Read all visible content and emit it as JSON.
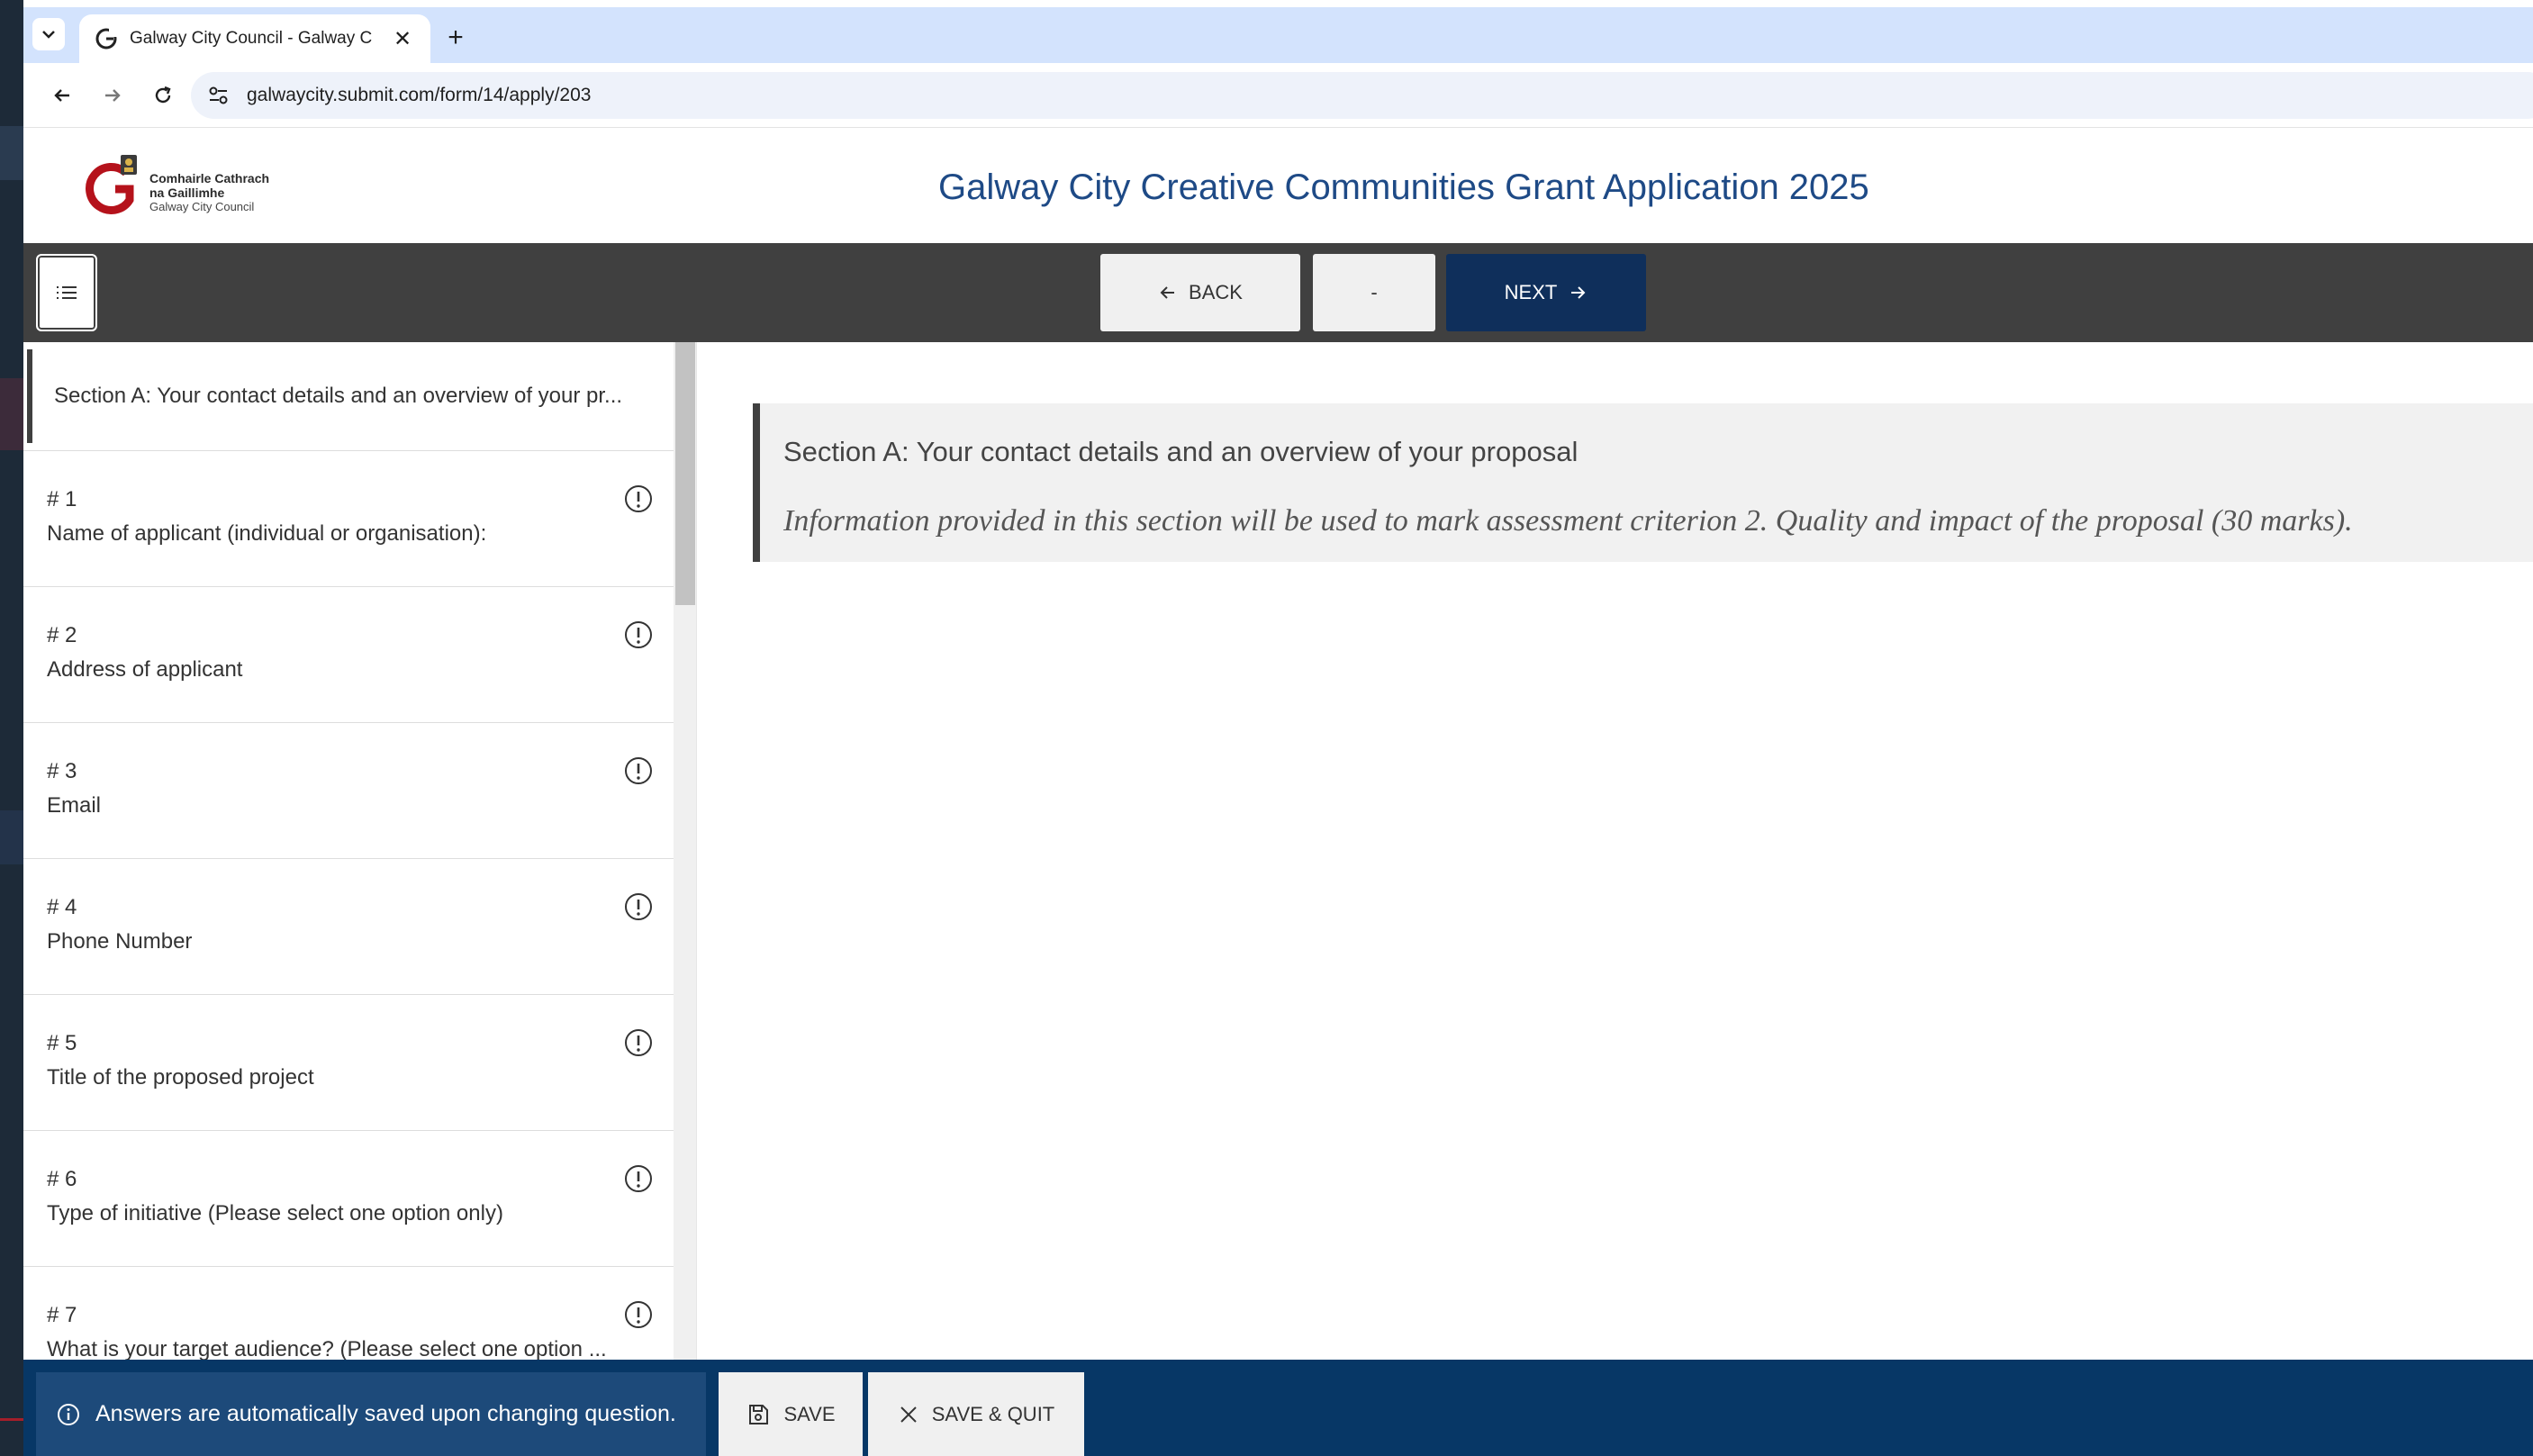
{
  "browser": {
    "tab_title": "Galway City Council - Galway C",
    "url": "galwaycity.submit.com/form/14/apply/203"
  },
  "header": {
    "logo_line1": "Comhairle Cathrach",
    "logo_line2": "na Gaillimhe",
    "logo_line3": "Galway City Council",
    "title": "Galway City Creative Communities Grant Application 2025"
  },
  "nav": {
    "back_label": "BACK",
    "middle_label": "-",
    "next_label": "NEXT"
  },
  "sidebar": {
    "section_label": "Section A: Your contact details and an overview of your pr...",
    "questions": [
      {
        "num": "# 1",
        "label": "Name of applicant (individual or organisation):"
      },
      {
        "num": "# 2",
        "label": "Address of applicant"
      },
      {
        "num": "# 3",
        "label": "Email"
      },
      {
        "num": "# 4",
        "label": "Phone Number"
      },
      {
        "num": "# 5",
        "label": "Title of the proposed project"
      },
      {
        "num": "# 6",
        "label": "Type of initiative (Please select one option only)"
      },
      {
        "num": "# 7",
        "label": "What is your target audience? (Please select one option ..."
      }
    ]
  },
  "main": {
    "section_title": "Section A: Your contact details and an overview of your proposal",
    "section_desc": "Information provided in this section will be used to mark assessment criterion 2. Quality and impact of the proposal (30 marks)."
  },
  "footer": {
    "autosave_text": "Answers are automatically saved upon changing question.",
    "save_label": "SAVE",
    "save_quit_label": "SAVE & QUIT"
  },
  "colors": {
    "brand_navy": "#0f2f5b",
    "footer_blue": "#073766",
    "nav_dark": "#404040",
    "title_blue": "#1e4a86",
    "logo_red": "#b5121b"
  }
}
